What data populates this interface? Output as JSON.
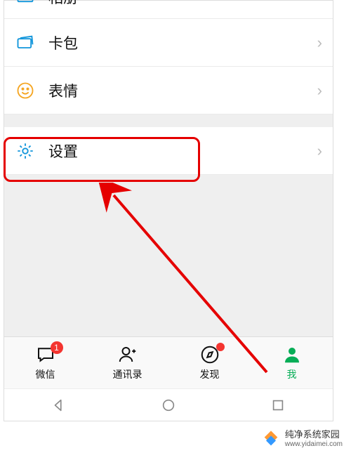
{
  "menu": {
    "album": {
      "label": "相册",
      "icon": "album-icon"
    },
    "cards": {
      "label": "卡包",
      "icon": "cards-icon"
    },
    "stickers": {
      "label": "表情",
      "icon": "sticker-icon"
    },
    "settings": {
      "label": "设置",
      "icon": "gear-icon"
    }
  },
  "tabs": {
    "chats": {
      "label": "微信",
      "badge": "1"
    },
    "contacts": {
      "label": "通讯录"
    },
    "discover": {
      "label": "发现",
      "dot": true
    },
    "me": {
      "label": "我",
      "active": true
    }
  },
  "colors": {
    "accent": "#06ad56",
    "iconBlue": "#1296db",
    "iconOrange": "#f5a623",
    "highlight": "#e50000",
    "badge": "#f43530"
  },
  "watermark": {
    "title": "纯净系统家园",
    "url": "www.yidaimei.com"
  }
}
